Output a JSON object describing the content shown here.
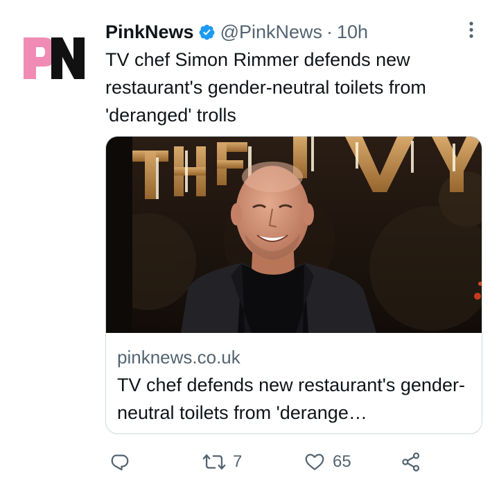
{
  "account": {
    "display_name": "PinkNews",
    "handle": "@PinkNews",
    "separator": "·",
    "time": "10h",
    "verified": true,
    "logo": {
      "brand_pink": "#f08cb4",
      "brand_black": "#111111"
    }
  },
  "tweet": {
    "text": "TV chef Simon Rimmer defends new restaurant's gender-neutral toilets from 'deranged' trolls"
  },
  "card": {
    "image": {
      "semantic": "photo-man-smiling-in-front-of-the-ivy-sign"
    },
    "domain": "pinknews.co.uk",
    "title": "TV chef defends new restaurant's gender-neutral toilets from 'derange…"
  },
  "actions": {
    "reply": {
      "icon": "reply-icon"
    },
    "retweet": {
      "icon": "retweet-icon",
      "count": "7"
    },
    "like": {
      "icon": "heart-icon",
      "count": "65"
    },
    "share": {
      "icon": "share-icon"
    }
  },
  "colors": {
    "secondary_text": "#536471",
    "verified_blue": "#1d9bf0",
    "border": "#cfd9de"
  }
}
